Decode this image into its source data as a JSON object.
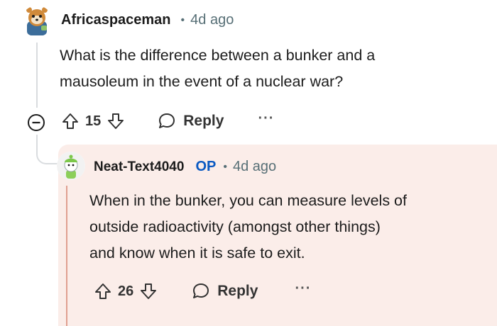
{
  "comment": {
    "author": "Africaspaceman",
    "separator": "•",
    "time": "4d ago",
    "body_lines": [
      "What is the difference between a bunker and a",
      "mausoleum in the event of a nuclear war?"
    ],
    "votes": "15",
    "reply_label": "Reply",
    "more_label": "···"
  },
  "reply": {
    "author": "Neat-Text4040",
    "badge": "OP",
    "separator": "•",
    "time": "4d ago",
    "body_lines": [
      "When in the bunker, you can measure levels of",
      "outside radioactivity (amongst other things)",
      "and know when it is safe to exit."
    ],
    "votes": "26",
    "reply_label": "Reply",
    "more_label": "···"
  },
  "colors": {
    "reply_bg": "#fbede9",
    "op_badge": "#0a59c2",
    "highlight_line": "#e0a090"
  },
  "icons": [
    "collapse-icon",
    "upvote-icon",
    "downvote-icon",
    "reply-icon",
    "more-icon"
  ]
}
